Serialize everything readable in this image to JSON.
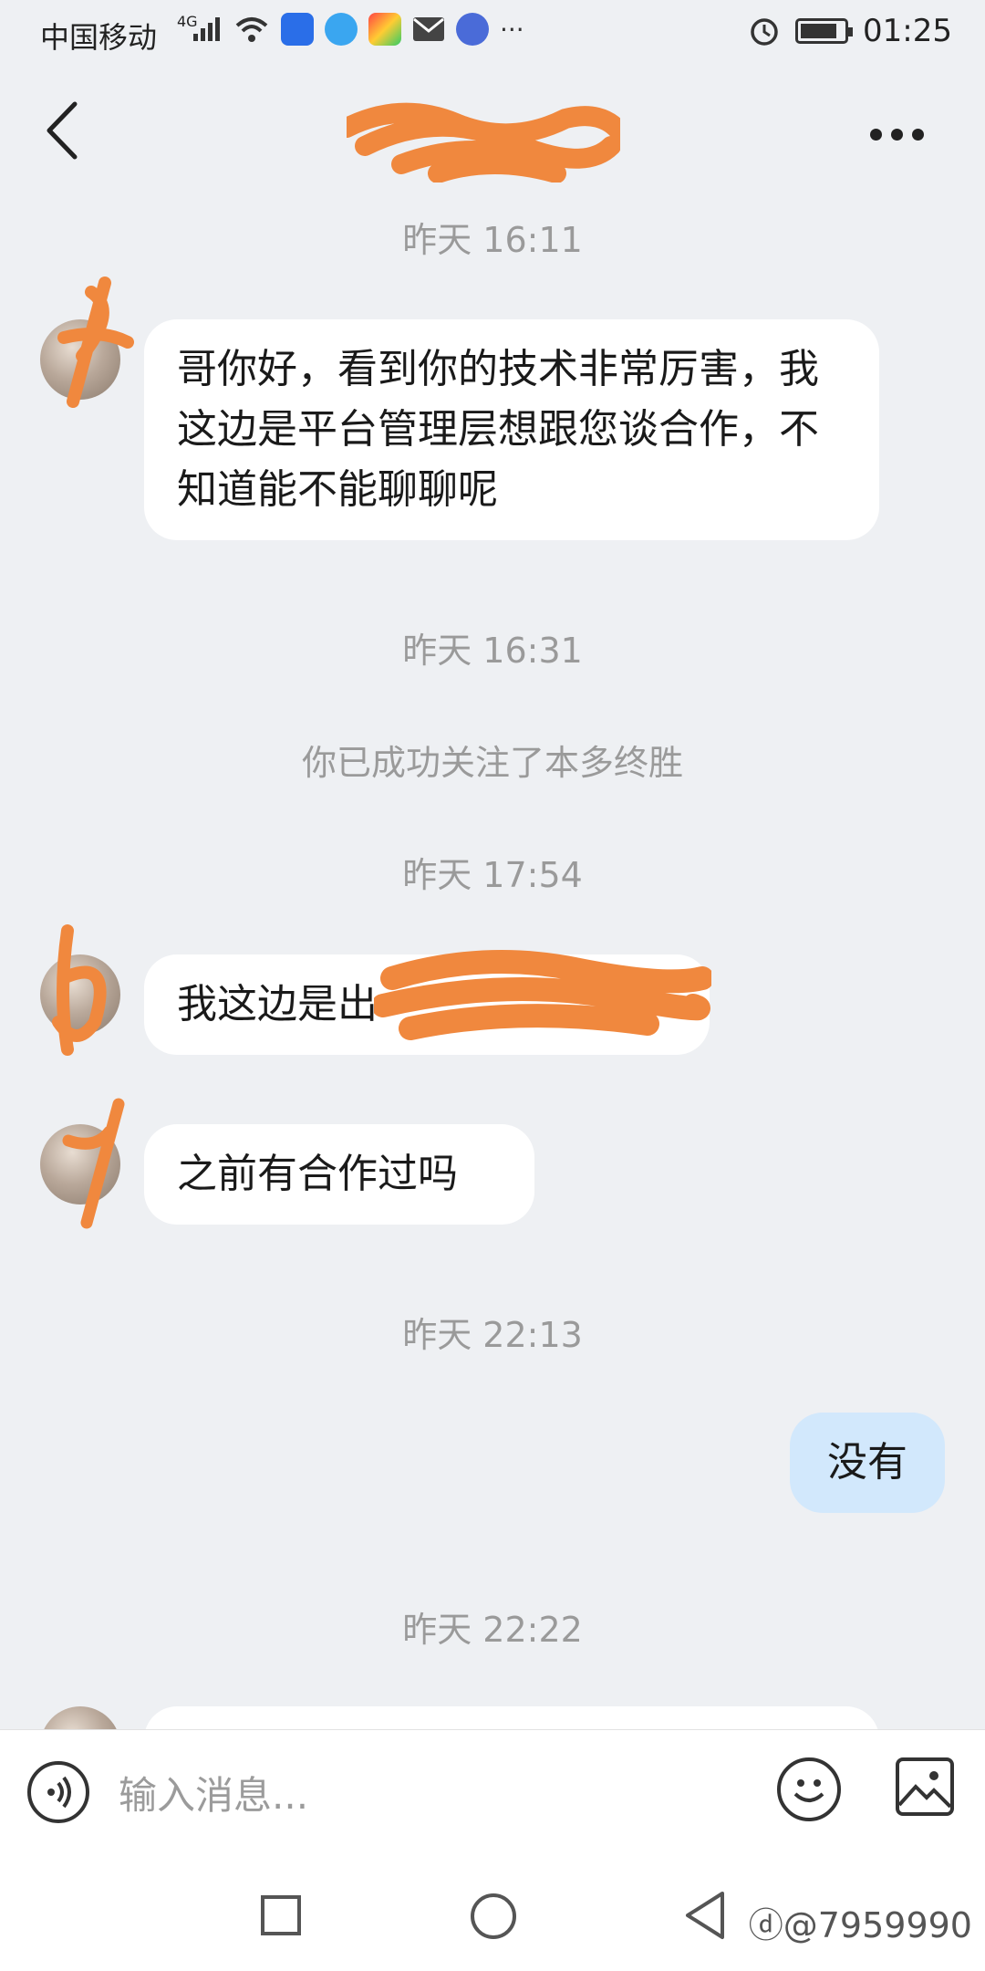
{
  "status_bar": {
    "carrier": "中国移动",
    "network": "4G",
    "time": "01:25",
    "battery_level": 0.85
  },
  "header": {
    "back_icon": "chevron-left-icon",
    "more_icon": "more-dots-icon"
  },
  "messages": [
    {
      "type": "timestamp",
      "text": "昨天 16:11"
    },
    {
      "type": "incoming",
      "text": "哥你好，看到你的技术非常厉害，我这边是平台管理层想跟您谈合作，不知道能不能聊聊呢"
    },
    {
      "type": "timestamp",
      "text": "昨天 16:31"
    },
    {
      "type": "system",
      "text": "你已成功关注了本多终胜"
    },
    {
      "type": "timestamp",
      "text": "昨天 17:54"
    },
    {
      "type": "incoming",
      "text": "我这边是出"
    },
    {
      "type": "incoming",
      "text": "之前有合作过吗"
    },
    {
      "type": "timestamp",
      "text": "昨天 22:13"
    },
    {
      "type": "outgoing",
      "text": "没有"
    },
    {
      "type": "timestamp",
      "text": "昨天 22:22"
    }
  ],
  "input_bar": {
    "placeholder": "输入消息..."
  },
  "watermark": "@7959990",
  "colors": {
    "background": "#eef0f3",
    "incoming_bubble": "#ffffff",
    "outgoing_bubble": "#d2e8fc",
    "redaction": "#f0883e"
  }
}
